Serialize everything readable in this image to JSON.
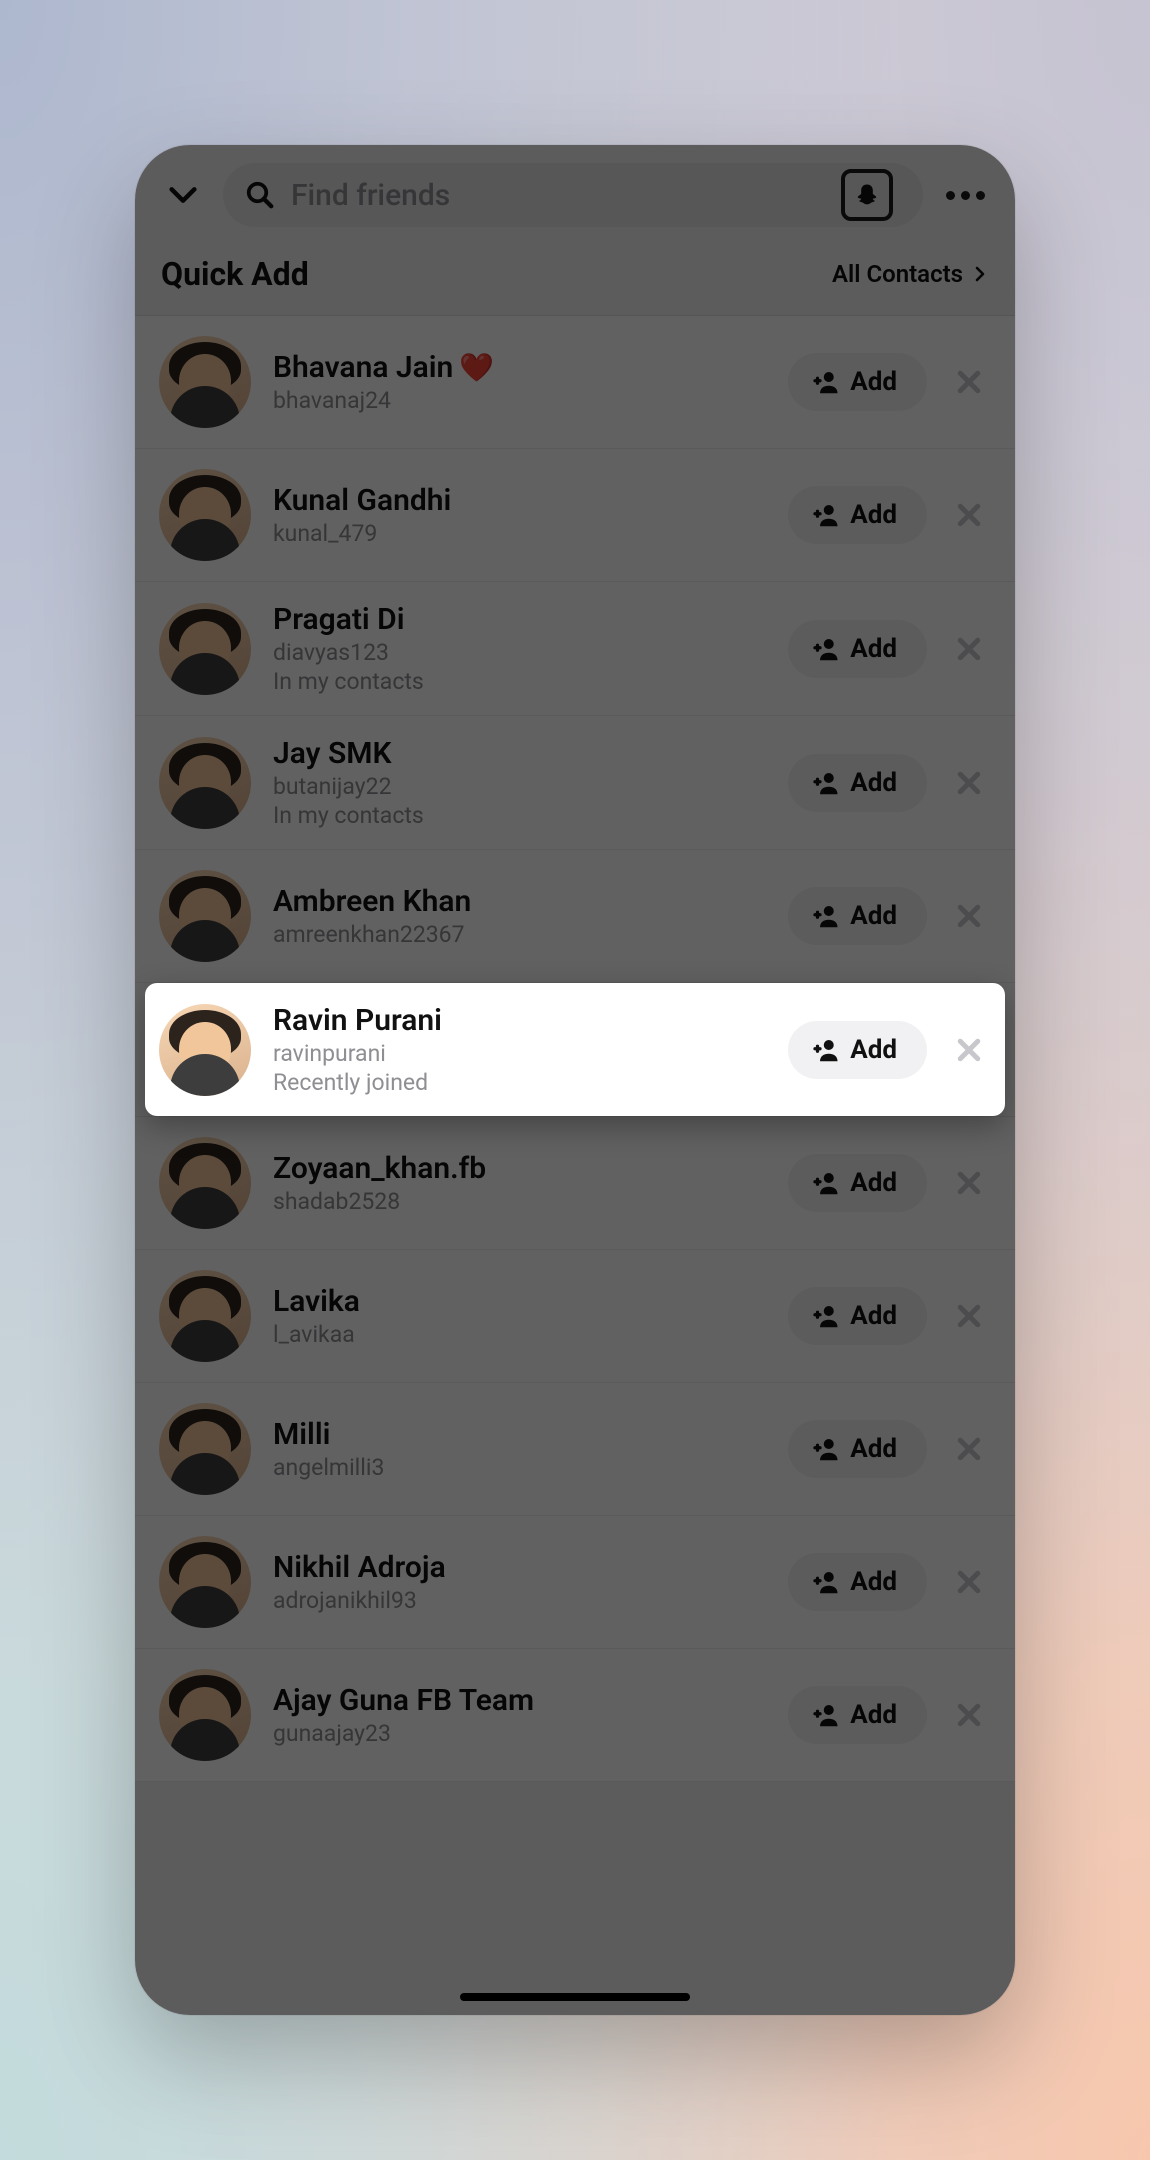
{
  "header": {
    "search_placeholder": "Find friends"
  },
  "section": {
    "title": "Quick Add",
    "link": "All Contacts"
  },
  "list": [
    {
      "name": "Bhavana Jain",
      "emoji": "❤️",
      "username": "bhavanaj24",
      "subtext": "",
      "add_label": "Add",
      "highlighted": false
    },
    {
      "name": "Kunal Gandhi",
      "emoji": "",
      "username": "kunal_479",
      "subtext": "",
      "add_label": "Add",
      "highlighted": false
    },
    {
      "name": "Pragati Di",
      "emoji": "",
      "username": "diavyas123",
      "subtext": "In my contacts",
      "add_label": "Add",
      "highlighted": false
    },
    {
      "name": "Jay SMK",
      "emoji": "",
      "username": "butanijay22",
      "subtext": "In my contacts",
      "add_label": "Add",
      "highlighted": false
    },
    {
      "name": "Ambreen Khan",
      "emoji": "",
      "username": "amreenkhan22367",
      "subtext": "",
      "add_label": "Add",
      "highlighted": false
    },
    {
      "name": "Ravin Purani",
      "emoji": "",
      "username": "ravinpurani",
      "subtext": "Recently joined",
      "add_label": "Add",
      "highlighted": true
    },
    {
      "name": "Zoyaan_khan.fb",
      "emoji": "",
      "username": "shadab2528",
      "subtext": "",
      "add_label": "Add",
      "highlighted": false
    },
    {
      "name": "Lavika",
      "emoji": "",
      "username": "l_avikaa",
      "subtext": "",
      "add_label": "Add",
      "highlighted": false
    },
    {
      "name": "Milli",
      "emoji": "",
      "username": "angelmilli3",
      "subtext": "",
      "add_label": "Add",
      "highlighted": false
    },
    {
      "name": "Nikhil Adroja",
      "emoji": "",
      "username": "adrojanikhil93",
      "subtext": "",
      "add_label": "Add",
      "highlighted": false
    },
    {
      "name": "Ajay Guna FB Team",
      "emoji": "",
      "username": "gunaajay23",
      "subtext": "",
      "add_label": "Add",
      "highlighted": false
    }
  ]
}
